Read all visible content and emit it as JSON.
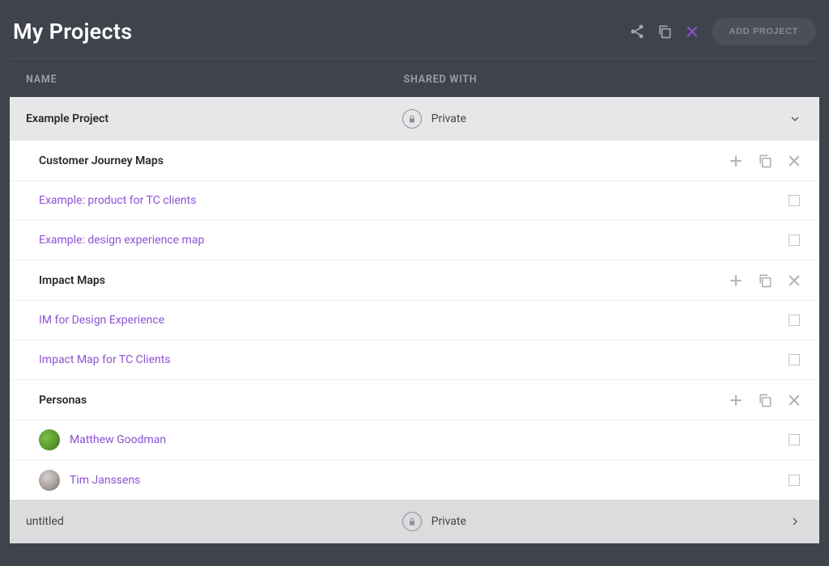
{
  "header": {
    "title": "My Projects",
    "add_button_label": "ADD PROJECT"
  },
  "columns": {
    "name": "NAME",
    "shared_with": "SHARED WITH"
  },
  "projects": [
    {
      "name": "Example Project",
      "sharing": "Private",
      "expanded": true,
      "groups": [
        {
          "title": "Customer Journey Maps",
          "items": [
            {
              "label": "Example: product for TC clients"
            },
            {
              "label": "Example: design experience map"
            }
          ]
        },
        {
          "title": "Impact Maps",
          "items": [
            {
              "label": "IM for Design Experience"
            },
            {
              "label": "Impact Map for TC Clients"
            }
          ]
        },
        {
          "title": "Personas",
          "items": [
            {
              "label": "Matthew Goodman",
              "avatar": "green"
            },
            {
              "label": "Tim Janssens",
              "avatar": "grey"
            }
          ]
        }
      ]
    },
    {
      "name": "untitled",
      "sharing": "Private",
      "expanded": false
    }
  ]
}
